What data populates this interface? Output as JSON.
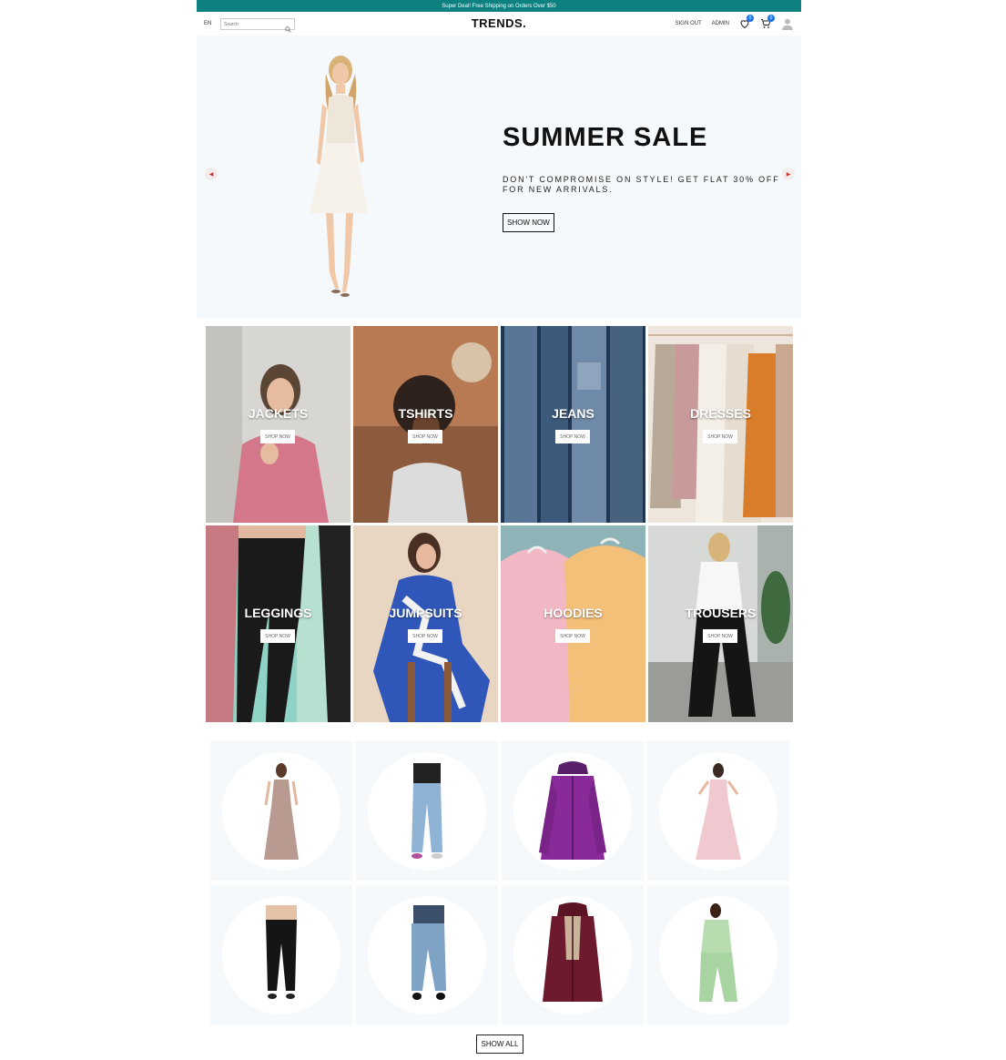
{
  "announcement": "Super Deal! Free Shipping on Orders Over $50",
  "nav": {
    "language": "EN",
    "search_placeholder": "Search",
    "logo": "TRENDS.",
    "sign_out": "SIGN OUT",
    "admin": "ADMIN",
    "wishlist_count": "0",
    "cart_count": "0"
  },
  "hero": {
    "title": "SUMMER SALE",
    "description": "DON'T COMPROMISE ON STYLE! GET FLAT 30% OFF FOR NEW ARRIVALS.",
    "button": "SHOW NOW"
  },
  "categories": [
    {
      "title": "JACKETS",
      "button": "SHOP NOW"
    },
    {
      "title": "TSHIRTS",
      "button": "SHOP NOW"
    },
    {
      "title": "JEANS",
      "button": "SHOP NOW"
    },
    {
      "title": "DRESSES",
      "button": "SHOP NOW"
    },
    {
      "title": "LEGGINGS",
      "button": "SHOP NOW"
    },
    {
      "title": "JUMPSUITS",
      "button": "SHOP NOW"
    },
    {
      "title": "HOODIES",
      "button": "SHOP NOW"
    },
    {
      "title": "TROUSERS",
      "button": "SHOP NOW"
    }
  ],
  "products_show_all": "SHOW ALL",
  "colors": {
    "announce_bg": "#0d8080",
    "badge": "#1a73e8",
    "hero_bg": "#f5f9fb"
  }
}
